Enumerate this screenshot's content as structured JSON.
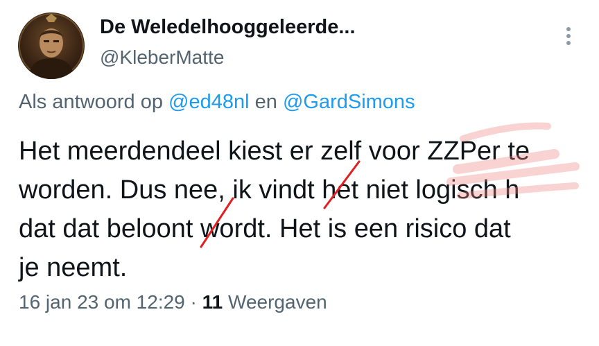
{
  "author": {
    "display_name": "De Weledelhooggeleerde...",
    "handle": "@KleberMatte"
  },
  "more_icon": "more-vertical-icon",
  "reply": {
    "prefix": "Als antwoord op",
    "mention_1": "@ed48nl",
    "conjunction": "en",
    "mention_2": "@GardSimons"
  },
  "tweet": {
    "lines": [
      "Het meerdendeel kiest er zelf voor ZZPer te",
      "worden. Dus nee, ik vindt het niet logisch h",
      "dat dat beloont wordt. Het is een risico dat",
      "je neemt."
    ]
  },
  "meta": {
    "date": "16 jan 23 om 12:29",
    "separator": "·",
    "views_count": "11",
    "views_label": "Weergaven"
  },
  "colors": {
    "text": "#0f1419",
    "secondary": "#536471",
    "link": "#1d9bf0",
    "highlight": "#f08080",
    "correction": "#e02020"
  }
}
